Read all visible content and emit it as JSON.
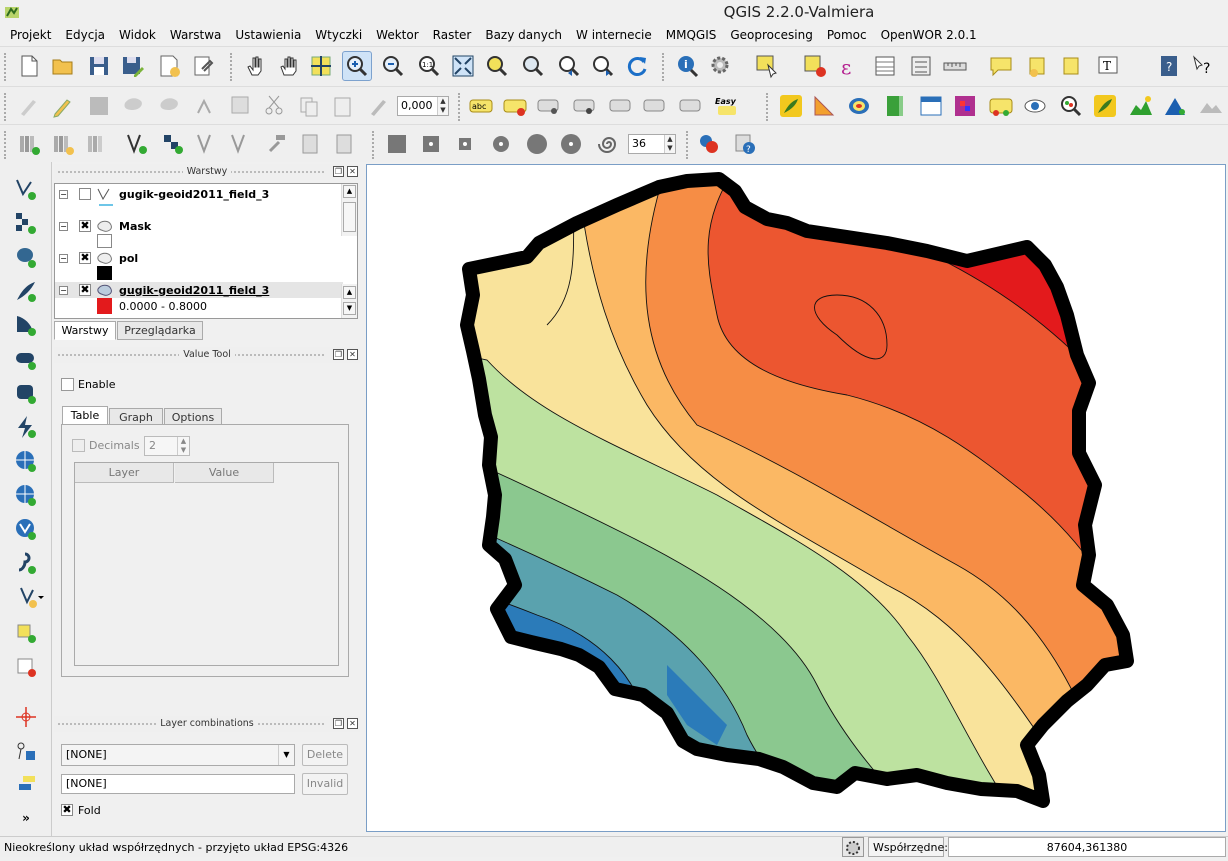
{
  "window": {
    "title": "QGIS 2.2.0-Valmiera"
  },
  "menu": [
    "Projekt",
    "Edycja",
    "Widok",
    "Warstwa",
    "Ustawienia",
    "Wtyczki",
    "Wektor",
    "Raster",
    "Bazy danych",
    "W internecie",
    "MMQGIS",
    "Geoprocesing",
    "Pomoc",
    "OpenWOR 2.0.1"
  ],
  "toolbar": {
    "scale_value": "0,000",
    "rotation_value": "36",
    "label_easy": "Easy",
    "label_abc": "abc",
    "btn_1to1": "1:1"
  },
  "layers_panel": {
    "title": "Warstwy",
    "items": [
      {
        "name": "gugik-geoid2011_field_3",
        "checked": false
      },
      {
        "name": "Mask",
        "checked": true
      },
      {
        "name": "pol",
        "checked": true
      },
      {
        "name": "gugik-geoid2011_field_3",
        "checked": true
      }
    ],
    "legend_first": "0.0000 - 0.8000",
    "check_mark": "✖",
    "expand_mark": "−",
    "tabs": [
      "Warstwy",
      "Przeglądarka"
    ]
  },
  "value_tool": {
    "title": "Value Tool",
    "enable_label": "Enable",
    "tabs": [
      "Table",
      "Graph",
      "Options"
    ],
    "decimals_label": "Decimals",
    "decimals_value": "2",
    "columns": [
      "Layer",
      "Value"
    ]
  },
  "layer_combinations": {
    "title": "Layer combinations",
    "combo_value": "[NONE]",
    "input_value": "[NONE]",
    "delete_label": "Delete",
    "invalid_label": "Invalid",
    "fold_label": "Fold",
    "fold_mark": "✖"
  },
  "statusbar": {
    "message": "Nieokreślony układ współrzędnych - przyjęto układ EPSG:4326",
    "coords_label": "Współrzędne:",
    "coords_value": "87604,361380"
  },
  "legend_colors": {
    "class_1": "#e31a1c",
    "outline": "#000000",
    "pol": "#000000"
  },
  "map_colors": [
    "#2b7bb9",
    "#5aa2ae",
    "#8bc88f",
    "#bde2a0",
    "#f9e39b",
    "#fbb864",
    "#f68d45",
    "#ec5630",
    "#e31a1c"
  ]
}
